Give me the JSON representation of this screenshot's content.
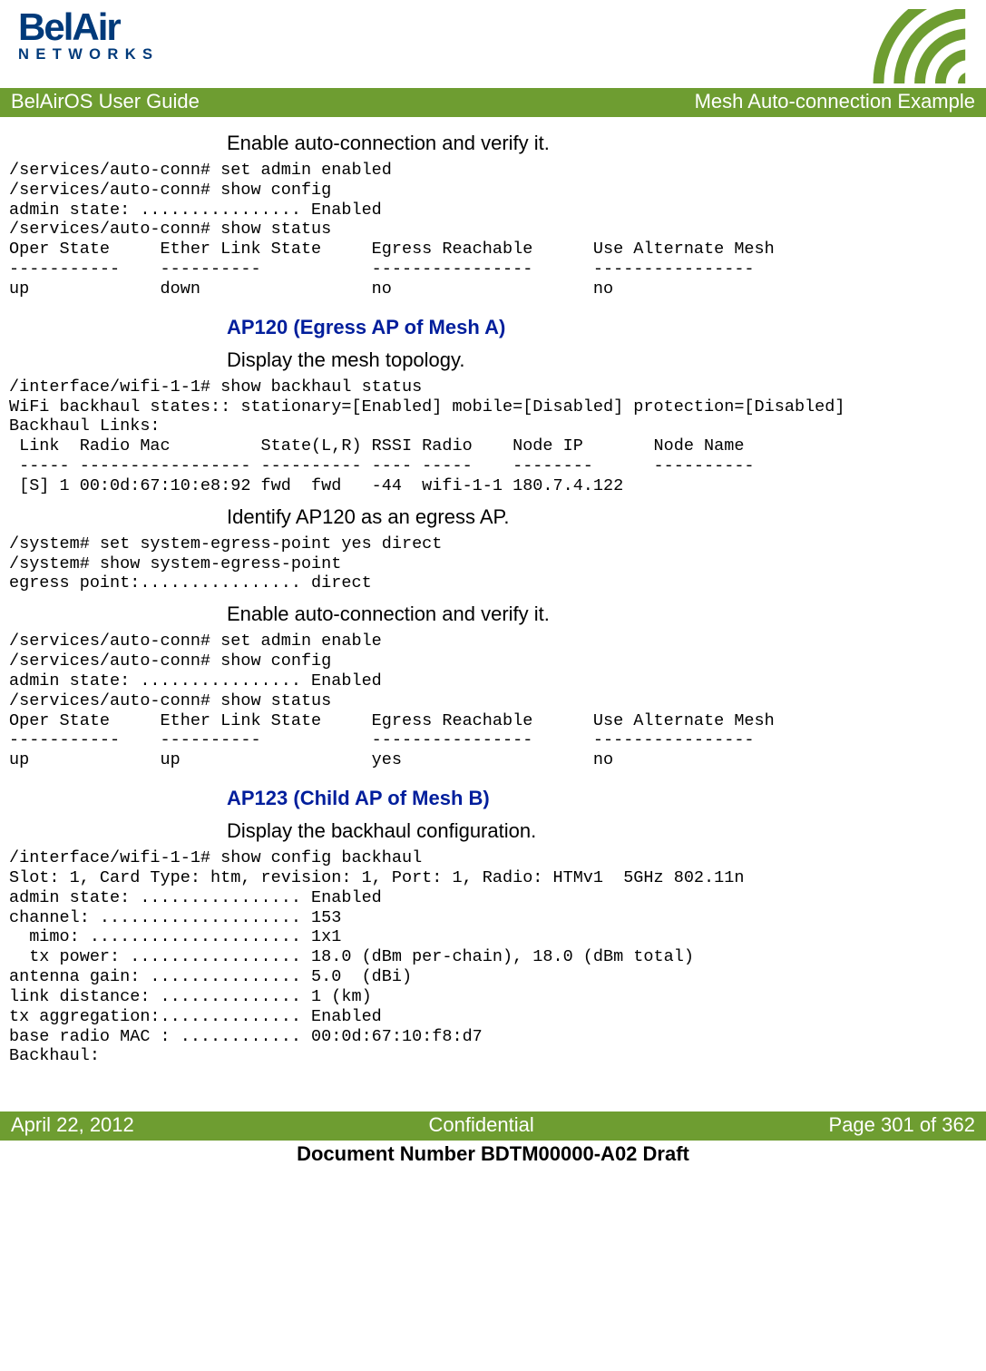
{
  "logo": {
    "top": "BelAir",
    "bottom": "NETWORKS"
  },
  "titlebar": {
    "left": "BelAirOS User Guide",
    "right": "Mesh Auto-connection Example"
  },
  "s1": {
    "step": "Enable auto-connection and verify it."
  },
  "term1": "/services/auto-conn# set admin enabled\n/services/auto-conn# show config\nadmin state: ................ Enabled\n/services/auto-conn# show status\nOper State     Ether Link State     Egress Reachable      Use Alternate Mesh\n-----------    ----------           ----------------      ----------------\nup             down                 no                    no",
  "s2": {
    "head": "AP120 (Egress AP of Mesh A)",
    "step": "Display the mesh topology."
  },
  "term2": "/interface/wifi-1-1# show backhaul status\nWiFi backhaul states:: stationary=[Enabled] mobile=[Disabled] protection=[Disabled]\nBackhaul Links:\n Link  Radio Mac         State(L,R) RSSI Radio    Node IP       Node Name\n ----- ----------------- ---------- ---- -----    --------      ----------\n [S] 1 00:0d:67:10:e8:92 fwd  fwd   -44  wifi-1-1 180.7.4.122",
  "s3": {
    "step": "Identify AP120 as an egress AP."
  },
  "term3": "/system# set system-egress-point yes direct\n/system# show system-egress-point\negress point:................ direct",
  "s4": {
    "step": "Enable auto-connection and verify it."
  },
  "term4": "/services/auto-conn# set admin enable\n/services/auto-conn# show config\nadmin state: ................ Enabled\n/services/auto-conn# show status\nOper State     Ether Link State     Egress Reachable      Use Alternate Mesh\n-----------    ----------           ----------------      ----------------\nup             up                   yes                   no",
  "s5": {
    "head": "AP123 (Child AP of Mesh B)",
    "step": "Display the backhaul configuration."
  },
  "term5": "/interface/wifi-1-1# show config backhaul\nSlot: 1, Card Type: htm, revision: 1, Port: 1, Radio: HTMv1  5GHz 802.11n\nadmin state: ................ Enabled\nchannel: .................... 153\n  mimo: ..................... 1x1\n  tx power: ................. 18.0 (dBm per-chain), 18.0 (dBm total)\nantenna gain: ............... 5.0  (dBi)\nlink distance: .............. 1 (km)\ntx aggregation:.............. Enabled\nbase radio MAC : ............ 00:0d:67:10:f8:d7\nBackhaul:",
  "footer": {
    "left": "April 22, 2012",
    "center": "Confidential",
    "right": "Page 301 of 362"
  },
  "docnum": "Document Number BDTM00000-A02 Draft"
}
